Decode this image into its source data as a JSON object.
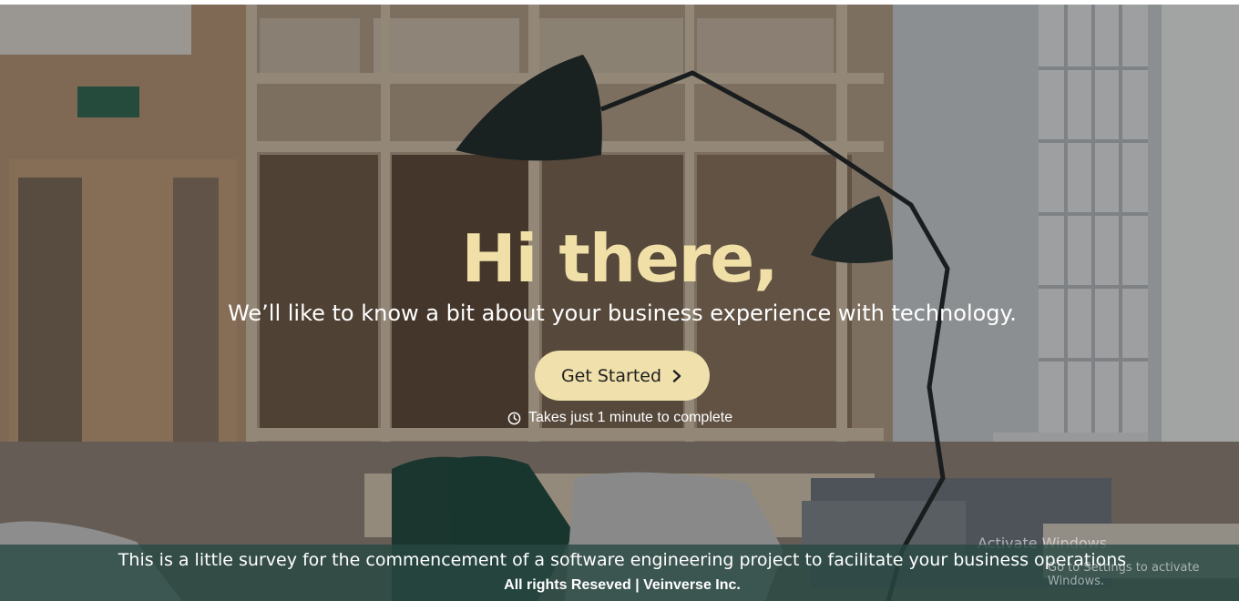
{
  "hero": {
    "title": "Hi there,",
    "subtitle": "We’ll like to know a bit about your business experience with technology.",
    "cta_label": "Get Started",
    "cta_icon": "chevron-right-icon",
    "time_note": "Takes just 1 minute to complete",
    "time_icon": "clock-icon"
  },
  "footer": {
    "description": "This is a little survey for the commencement of a software engineering project to facilitate your business operations",
    "copyright": "All rights Reseved | Veinverse Inc."
  },
  "watermark": {
    "title": "Activate Windows",
    "subtitle": "Go to Settings to activate Windows."
  },
  "colors": {
    "accent": "#efe0ac",
    "title": "#f0e0a8",
    "footer_bg": "#284842"
  }
}
